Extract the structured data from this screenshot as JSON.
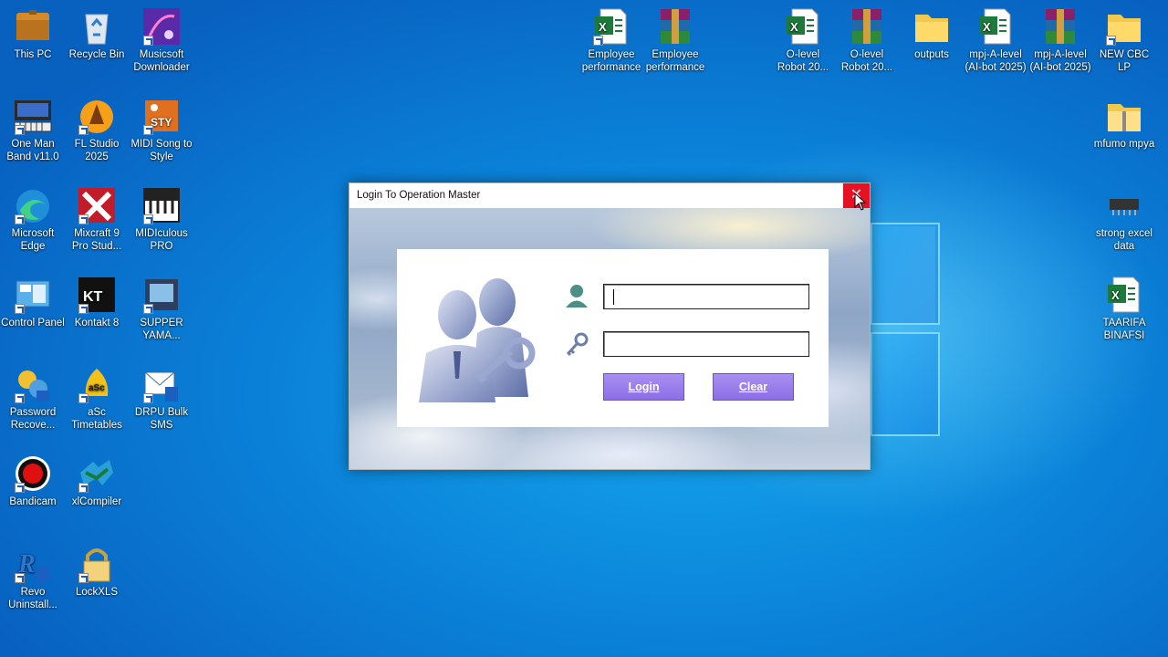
{
  "desktop": {
    "left_icons": [
      {
        "label": "This PC",
        "icon": "this-pc-icon"
      },
      {
        "label": "Recycle Bin",
        "icon": "recycle-bin-icon"
      },
      {
        "label": "Musicsoft Downloader",
        "icon": "musicsoft-icon"
      },
      {
        "label": "One Man Band v11.0",
        "icon": "one-man-band-icon"
      },
      {
        "label": "FL Studio 2025",
        "icon": "fl-studio-icon"
      },
      {
        "label": "MIDI Song to Style",
        "icon": "midi-song-icon"
      },
      {
        "label": "Microsoft Edge",
        "icon": "edge-icon"
      },
      {
        "label": "Mixcraft 9 Pro Stud...",
        "icon": "mixcraft-icon"
      },
      {
        "label": "MIDIculous PRO",
        "icon": "midiculous-icon"
      },
      {
        "label": "Control Panel",
        "icon": "control-panel-icon"
      },
      {
        "label": "Kontakt 8",
        "icon": "kontakt-icon"
      },
      {
        "label": "SUPPER YAMA...",
        "icon": "supper-yama-icon"
      },
      {
        "label": "Password Recove...",
        "icon": "password-recovery-icon"
      },
      {
        "label": "aSc Timetables",
        "icon": "asc-timetables-icon"
      },
      {
        "label": "DRPU Bulk SMS",
        "icon": "drpu-sms-icon"
      },
      {
        "label": "Bandicam",
        "icon": "bandicam-icon"
      },
      {
        "label": "xlCompiler",
        "icon": "xlcompiler-icon"
      },
      {
        "label": "Revo Uninstall...",
        "icon": "revo-uninstaller-icon"
      },
      {
        "label": "LockXLS",
        "icon": "lockxls-icon"
      }
    ],
    "top_icons": [
      {
        "label": "Employee performance",
        "icon": "excel-file-icon"
      },
      {
        "label": "Employee performance",
        "icon": "winrar-archive-icon"
      },
      {
        "label": "O-level Robot 20...",
        "icon": "excel-file-icon"
      },
      {
        "label": "O-level Robot 20...",
        "icon": "winrar-archive-icon"
      },
      {
        "label": "outputs",
        "icon": "folder-icon"
      },
      {
        "label": "mpj-A-level (AI-bot 2025)",
        "icon": "excel-file-icon"
      },
      {
        "label": "mpj-A-level (AI-bot 2025)",
        "icon": "winrar-archive-icon"
      },
      {
        "label": "NEW CBC LP",
        "icon": "folder-icon"
      }
    ],
    "right_icons": [
      {
        "label": "mfumo mpya",
        "icon": "zip-folder-icon"
      },
      {
        "label": "strong excel data",
        "icon": "chip-icon"
      },
      {
        "label": "TAARIFA BINAFSI",
        "icon": "excel-file-icon"
      }
    ]
  },
  "dialog": {
    "title": "Login To Operation Master",
    "close_symbol": "✕",
    "username": {
      "value": "",
      "placeholder": ""
    },
    "password": {
      "value": "",
      "placeholder": ""
    },
    "login_label": "Login",
    "clear_label": "Clear"
  },
  "colors": {
    "close_red": "#e81123",
    "button_purple": "#9478ec",
    "desktop_blue": "#0a7fd6"
  }
}
